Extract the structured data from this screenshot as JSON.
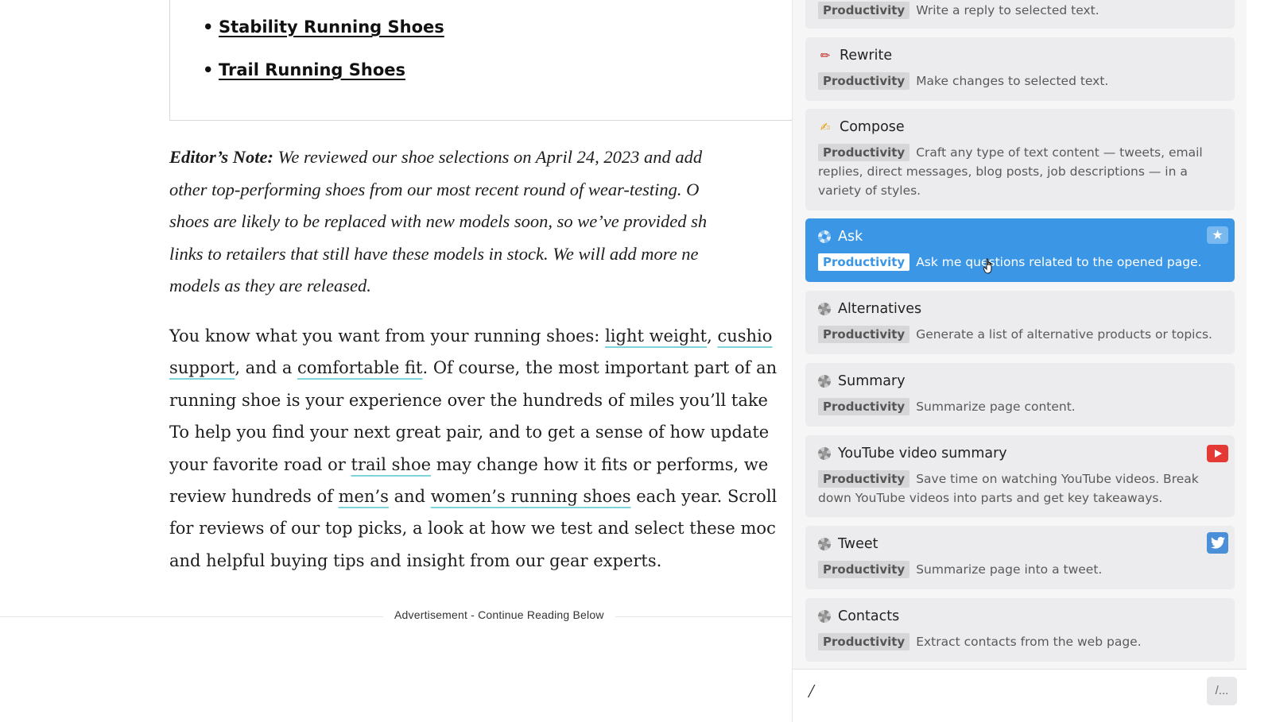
{
  "article": {
    "toc": [
      "Stability Running Shoes",
      "Trail Running Shoes"
    ],
    "editor_note": {
      "label": "Editor’s Note:",
      "lines": [
        " We reviewed our shoe selections on April 24, 2023 and add",
        "other top-performing shoes from our most recent round of wear-testing. O",
        "shoes are likely to be replaced with new models soon, so we’ve provided sh",
        "links to retailers that still have these models in stock. We will add more ne",
        "models as they are released."
      ]
    },
    "body": {
      "l1_a": "You know what you want from your running shoes: ",
      "l1_link1": "light weight",
      "l1_b": ", ",
      "l1_link2": "cushio",
      "l2_link1": "support",
      "l2_a": ", and a ",
      "l2_link2": "comfortable fit",
      "l2_b": ". Of course, the most important part of an",
      "l3": "running shoe is your experience over the hundreds of miles you’ll take",
      "l4": "To help you find your next great pair, and to get a sense of how update",
      "l5_a": "your favorite road or ",
      "l5_link": "trail shoe",
      "l5_b": " may change how it fits or performs, we",
      "l6_a": "review hundreds of ",
      "l6_link1": "men’s",
      "l6_b": " and ",
      "l6_link2": "women’s running shoes",
      "l6_c": " each year. Scroll",
      "l7": "for reviews of our top picks, a look at how we test and select these moc",
      "l8": "and helpful buying tips and insight from our gear experts."
    },
    "ad_label": "Advertisement - Continue Reading Below"
  },
  "panel": {
    "partial_card": {
      "tag": "Productivity",
      "desc": "Write a reply to selected text."
    },
    "cards": [
      {
        "title": "Rewrite",
        "icon": "pencil-icon",
        "tag": "Productivity",
        "desc": "Make changes to selected text."
      },
      {
        "title": "Compose",
        "icon": "writing-hand-icon",
        "tag": "Productivity",
        "desc": "Craft any type of text content — tweets, email replies, direct messages, blog posts, job descriptions — in a variety of styles."
      },
      {
        "title": "Ask",
        "icon": "gear-icon",
        "tag": "Productivity",
        "desc": "Ask me questions related to the opened page.",
        "active": true,
        "badge": "star-icon"
      },
      {
        "title": "Alternatives",
        "icon": "gear-icon",
        "tag": "Productivity",
        "desc": "Generate a list of alternative products or topics."
      },
      {
        "title": "Summary",
        "icon": "gear-icon",
        "tag": "Productivity",
        "desc": "Summarize page content."
      },
      {
        "title": "YouTube video summary",
        "icon": "gear-icon",
        "tag": "Productivity",
        "desc": "Save time on watching YouTube videos. Break down YouTube videos into parts and get key takeaways.",
        "badge": "youtube-icon"
      },
      {
        "title": "Tweet",
        "icon": "gear-icon",
        "tag": "Productivity",
        "desc": "Summarize page into a tweet.",
        "badge": "twitter-icon"
      },
      {
        "title": "Contacts",
        "icon": "gear-icon",
        "tag": "Productivity",
        "desc": "Extract contacts from the web page."
      }
    ],
    "input_value": "/",
    "command_button": "/..."
  },
  "colors": {
    "active_card": "#3b97e6",
    "link_underline": "#7ed3d8"
  }
}
